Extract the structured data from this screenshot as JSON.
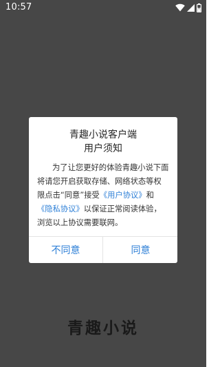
{
  "status_bar": {
    "time": "10:57",
    "icons": [
      "wifi-icon",
      "signal-icon",
      "battery-icon"
    ]
  },
  "dialog": {
    "title": "青趣小说客户端",
    "subtitle": "用户须知",
    "body": {
      "part1": "为了让您更好的体验青趣小说下面将请您开启获取存储、网络状态等权限点击“同意”接受",
      "link_user_agreement": "《用户协议》",
      "connector": "和",
      "link_privacy": "《隐私协议》",
      "part2": "以保证正常阅读体验，浏览以上协议需要联网。"
    },
    "buttons": {
      "disagree": "不同意",
      "agree": "同意"
    }
  },
  "app_logo": "青趣小说",
  "colors": {
    "background_overlay": "#474747",
    "link": "#2f80d7",
    "dialog_bg": "#ffffff"
  }
}
